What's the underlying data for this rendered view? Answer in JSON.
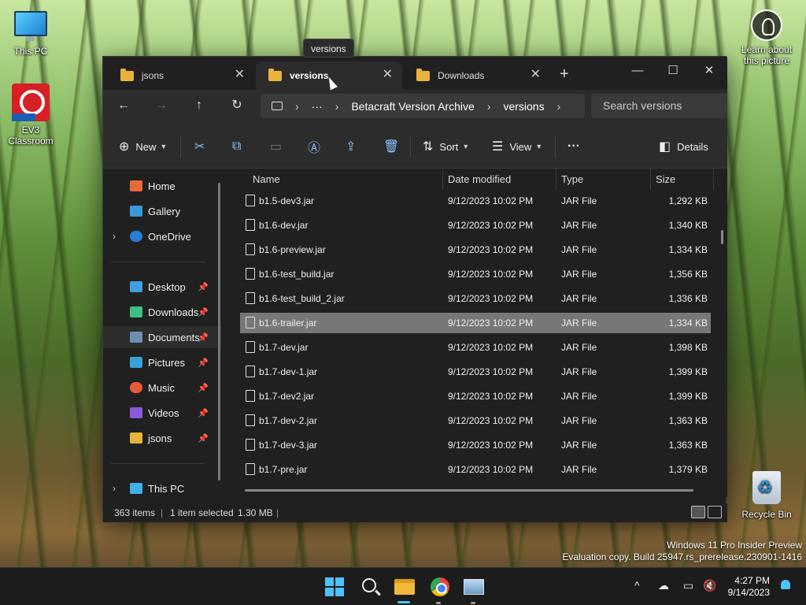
{
  "desktop": {
    "icons": [
      {
        "label": "This PC"
      },
      {
        "label": "EV3 Classroom"
      },
      {
        "label": "Learn about this picture"
      },
      {
        "label": "Recycle Bin"
      }
    ],
    "watermark_line1": "Windows 11 Pro Insider Preview",
    "watermark_line2": "Evaluation copy. Build 25947.rs_prerelease.230901-1416"
  },
  "tooltip": "versions",
  "window": {
    "tabs": [
      {
        "label": "jsons",
        "active": false
      },
      {
        "label": "versions",
        "active": true
      },
      {
        "label": "Downloads",
        "active": false
      }
    ],
    "controls": {
      "minimize": "—",
      "maximize": "☐",
      "close": "✕"
    },
    "address": {
      "ellipsis": "···",
      "crumbs": [
        "Betacraft Version Archive",
        "versions"
      ]
    },
    "search_placeholder": "Search versions",
    "toolbar": {
      "new_label": "New",
      "sort_label": "Sort",
      "view_label": "View",
      "more_label": "···",
      "details_label": "Details"
    },
    "sidebar": {
      "items": [
        {
          "label": "Home",
          "icon": "home-icon",
          "color": "#e86a3a"
        },
        {
          "label": "Gallery",
          "icon": "gallery-icon",
          "color": "#3a9ad9"
        },
        {
          "label": "OneDrive",
          "icon": "onedrive-icon",
          "color": "#2b7cd3"
        },
        {
          "label": "Desktop",
          "icon": "desktop-icon",
          "color": "#3fa0e0"
        },
        {
          "label": "Downloads",
          "icon": "downloads-icon",
          "color": "#3fbf7f"
        },
        {
          "label": "Documents",
          "icon": "documents-icon",
          "color": "#6d8fb0"
        },
        {
          "label": "Pictures",
          "icon": "pictures-icon",
          "color": "#3aa0d8"
        },
        {
          "label": "Music",
          "icon": "music-icon",
          "color": "#e85a3a"
        },
        {
          "label": "Videos",
          "icon": "videos-icon",
          "color": "#8a5ad8"
        },
        {
          "label": "jsons",
          "icon": "folder-icon",
          "color": "#e8b33a"
        },
        {
          "label": "This PC",
          "icon": "this-pc-icon",
          "color": "#3fb0e8"
        }
      ]
    },
    "columns": {
      "name": "Name",
      "date": "Date modified",
      "type": "Type",
      "size": "Size"
    },
    "files": [
      {
        "name": "b1.5-dev3.jar",
        "date": "9/12/2023 10:02 PM",
        "type": "JAR File",
        "size": "1,292 KB"
      },
      {
        "name": "b1.6-dev.jar",
        "date": "9/12/2023 10:02 PM",
        "type": "JAR File",
        "size": "1,340 KB"
      },
      {
        "name": "b1.6-preview.jar",
        "date": "9/12/2023 10:02 PM",
        "type": "JAR File",
        "size": "1,334 KB"
      },
      {
        "name": "b1.6-test_build.jar",
        "date": "9/12/2023 10:02 PM",
        "type": "JAR File",
        "size": "1,356 KB"
      },
      {
        "name": "b1.6-test_build_2.jar",
        "date": "9/12/2023 10:02 PM",
        "type": "JAR File",
        "size": "1,336 KB"
      },
      {
        "name": "b1.6-trailer.jar",
        "date": "9/12/2023 10:02 PM",
        "type": "JAR File",
        "size": "1,334 KB",
        "selected": true
      },
      {
        "name": "b1.7-dev.jar",
        "date": "9/12/2023 10:02 PM",
        "type": "JAR File",
        "size": "1,398 KB"
      },
      {
        "name": "b1.7-dev-1.jar",
        "date": "9/12/2023 10:02 PM",
        "type": "JAR File",
        "size": "1,399 KB"
      },
      {
        "name": "b1.7-dev2.jar",
        "date": "9/12/2023 10:02 PM",
        "type": "JAR File",
        "size": "1,399 KB"
      },
      {
        "name": "b1.7-dev-2.jar",
        "date": "9/12/2023 10:02 PM",
        "type": "JAR File",
        "size": "1,363 KB"
      },
      {
        "name": "b1.7-dev-3.jar",
        "date": "9/12/2023 10:02 PM",
        "type": "JAR File",
        "size": "1,363 KB"
      },
      {
        "name": "b1.7-pre.jar",
        "date": "9/12/2023 10:02 PM",
        "type": "JAR File",
        "size": "1,379 KB"
      }
    ],
    "status": {
      "items_count": "363 items",
      "selected": "1 item selected",
      "selected_size": "1.30 MB"
    }
  },
  "taskbar": {
    "clock_time": "4:27 PM",
    "clock_date": "9/14/2023",
    "accent": "#4cc2ff"
  }
}
